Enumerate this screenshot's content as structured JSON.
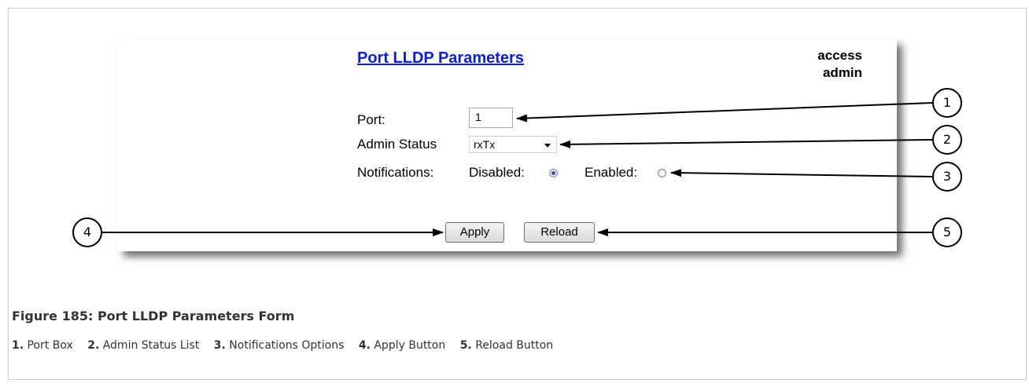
{
  "form": {
    "title": "Port LLDP Parameters",
    "access_line1": "access",
    "access_line2": "admin",
    "port_label": "Port:",
    "port_value": "1",
    "admin_status_label": "Admin Status",
    "admin_status_value": "rxTx",
    "notifications_label": "Notifications:",
    "disabled_label": "Disabled:",
    "enabled_label": "Enabled:",
    "notifications_selected": "Disabled",
    "apply_label": "Apply",
    "reload_label": "Reload"
  },
  "callouts": [
    "1",
    "2",
    "3",
    "4",
    "5"
  ],
  "caption": "Figure 185: Port LLDP Parameters Form",
  "legend": [
    {
      "num": "1.",
      "text": "Port Box"
    },
    {
      "num": "2.",
      "text": "Admin Status List"
    },
    {
      "num": "3.",
      "text": "Notifications Options"
    },
    {
      "num": "4.",
      "text": "Apply Button"
    },
    {
      "num": "5.",
      "text": "Reload Button"
    }
  ]
}
